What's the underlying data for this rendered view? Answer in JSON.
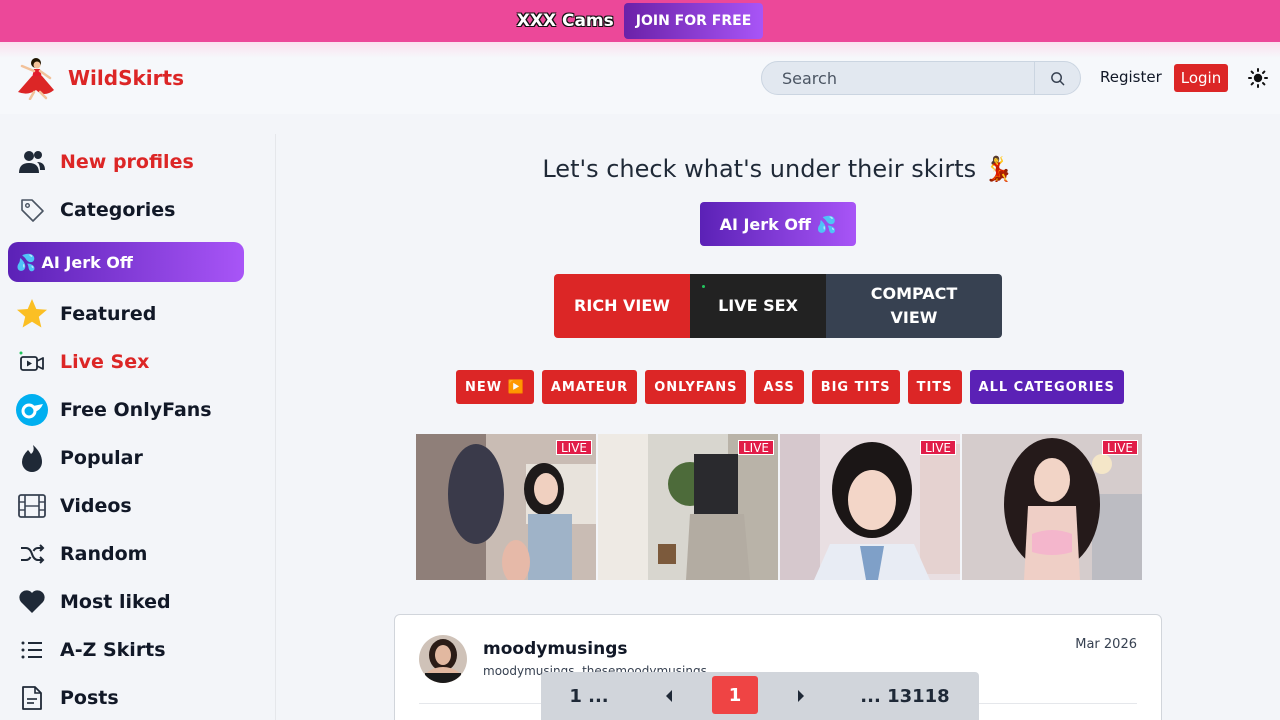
{
  "promo": {
    "title": "XXX Cams",
    "cta": "JOIN FOR FREE",
    "cta_gradient": [
      "#6b21a8",
      "#a855f7"
    ],
    "bg_color": "#ec4899"
  },
  "header": {
    "logo_icon": "dancer-icon",
    "logo_text": "WildSkirts",
    "search_placeholder": "Search",
    "register": "Register",
    "login": "Login",
    "theme_icon": "sun-icon"
  },
  "sidebar": {
    "items": [
      {
        "label": "New profiles",
        "icon": "users-icon",
        "color": "#dc2626"
      },
      {
        "label": "Categories",
        "icon": "tag-icon"
      },
      {
        "label": "💦 AI Jerk Off",
        "icon": "droplets-icon"
      },
      {
        "label": "Featured",
        "icon": "star-icon"
      },
      {
        "label": "Live Sex",
        "icon": "video-camera-icon",
        "color": "#dc2626"
      },
      {
        "label": "Free OnlyFans",
        "icon": "onlyfans-icon"
      },
      {
        "label": "Popular",
        "icon": "flame-icon"
      },
      {
        "label": "Videos",
        "icon": "film-icon"
      },
      {
        "label": "Random",
        "icon": "shuffle-icon"
      },
      {
        "label": "Most liked",
        "icon": "heart-icon"
      },
      {
        "label": "A-Z Skirts",
        "icon": "list-icon"
      },
      {
        "label": "Posts",
        "icon": "document-icon"
      }
    ]
  },
  "main": {
    "headline": "Let's check what's under their skirts 💃",
    "ai_button": "AI Jerk Off 💦",
    "views": [
      {
        "label": "RICH VIEW",
        "color": "#dc2626"
      },
      {
        "label": "LIVE SEX",
        "color": "#222222"
      },
      {
        "label": "COMPACT VIEW",
        "color": "#374151"
      }
    ],
    "categories": [
      "NEW ▶️",
      "AMATEUR",
      "ONLYFANS",
      "ASS",
      "BIG TITS",
      "TITS",
      "ALL CATEGORIES"
    ],
    "live_label": "LIVE",
    "card": {
      "name": "moodymusings",
      "aliases": "moodymusings, thesemoodymusings",
      "date": "Mar 2026"
    },
    "pager": {
      "first": "1 ...",
      "current": "1",
      "last": "... 13118"
    }
  }
}
